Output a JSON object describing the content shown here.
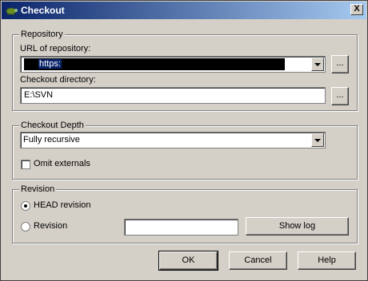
{
  "window": {
    "title": "Checkout",
    "close_glyph": "X"
  },
  "repository": {
    "legend": "Repository",
    "url_label": "URL of repository:",
    "url_value": "https:",
    "browse_label": "...",
    "dir_label": "Checkout directory:",
    "dir_value": "E:\\SVN",
    "dir_browse_label": "..."
  },
  "depth": {
    "legend": "Checkout Depth",
    "selected": "Fully recursive",
    "omit_label": "Omit externals"
  },
  "revision": {
    "legend": "Revision",
    "head_label": "HEAD revision",
    "rev_label": "Revision",
    "rev_value": "",
    "show_log_label": "Show log"
  },
  "buttons": {
    "ok": "OK",
    "cancel": "Cancel",
    "help": "Help"
  },
  "colors": {
    "title_start": "#0a246a",
    "title_end": "#a6caf0",
    "face": "#d4d0c8"
  }
}
